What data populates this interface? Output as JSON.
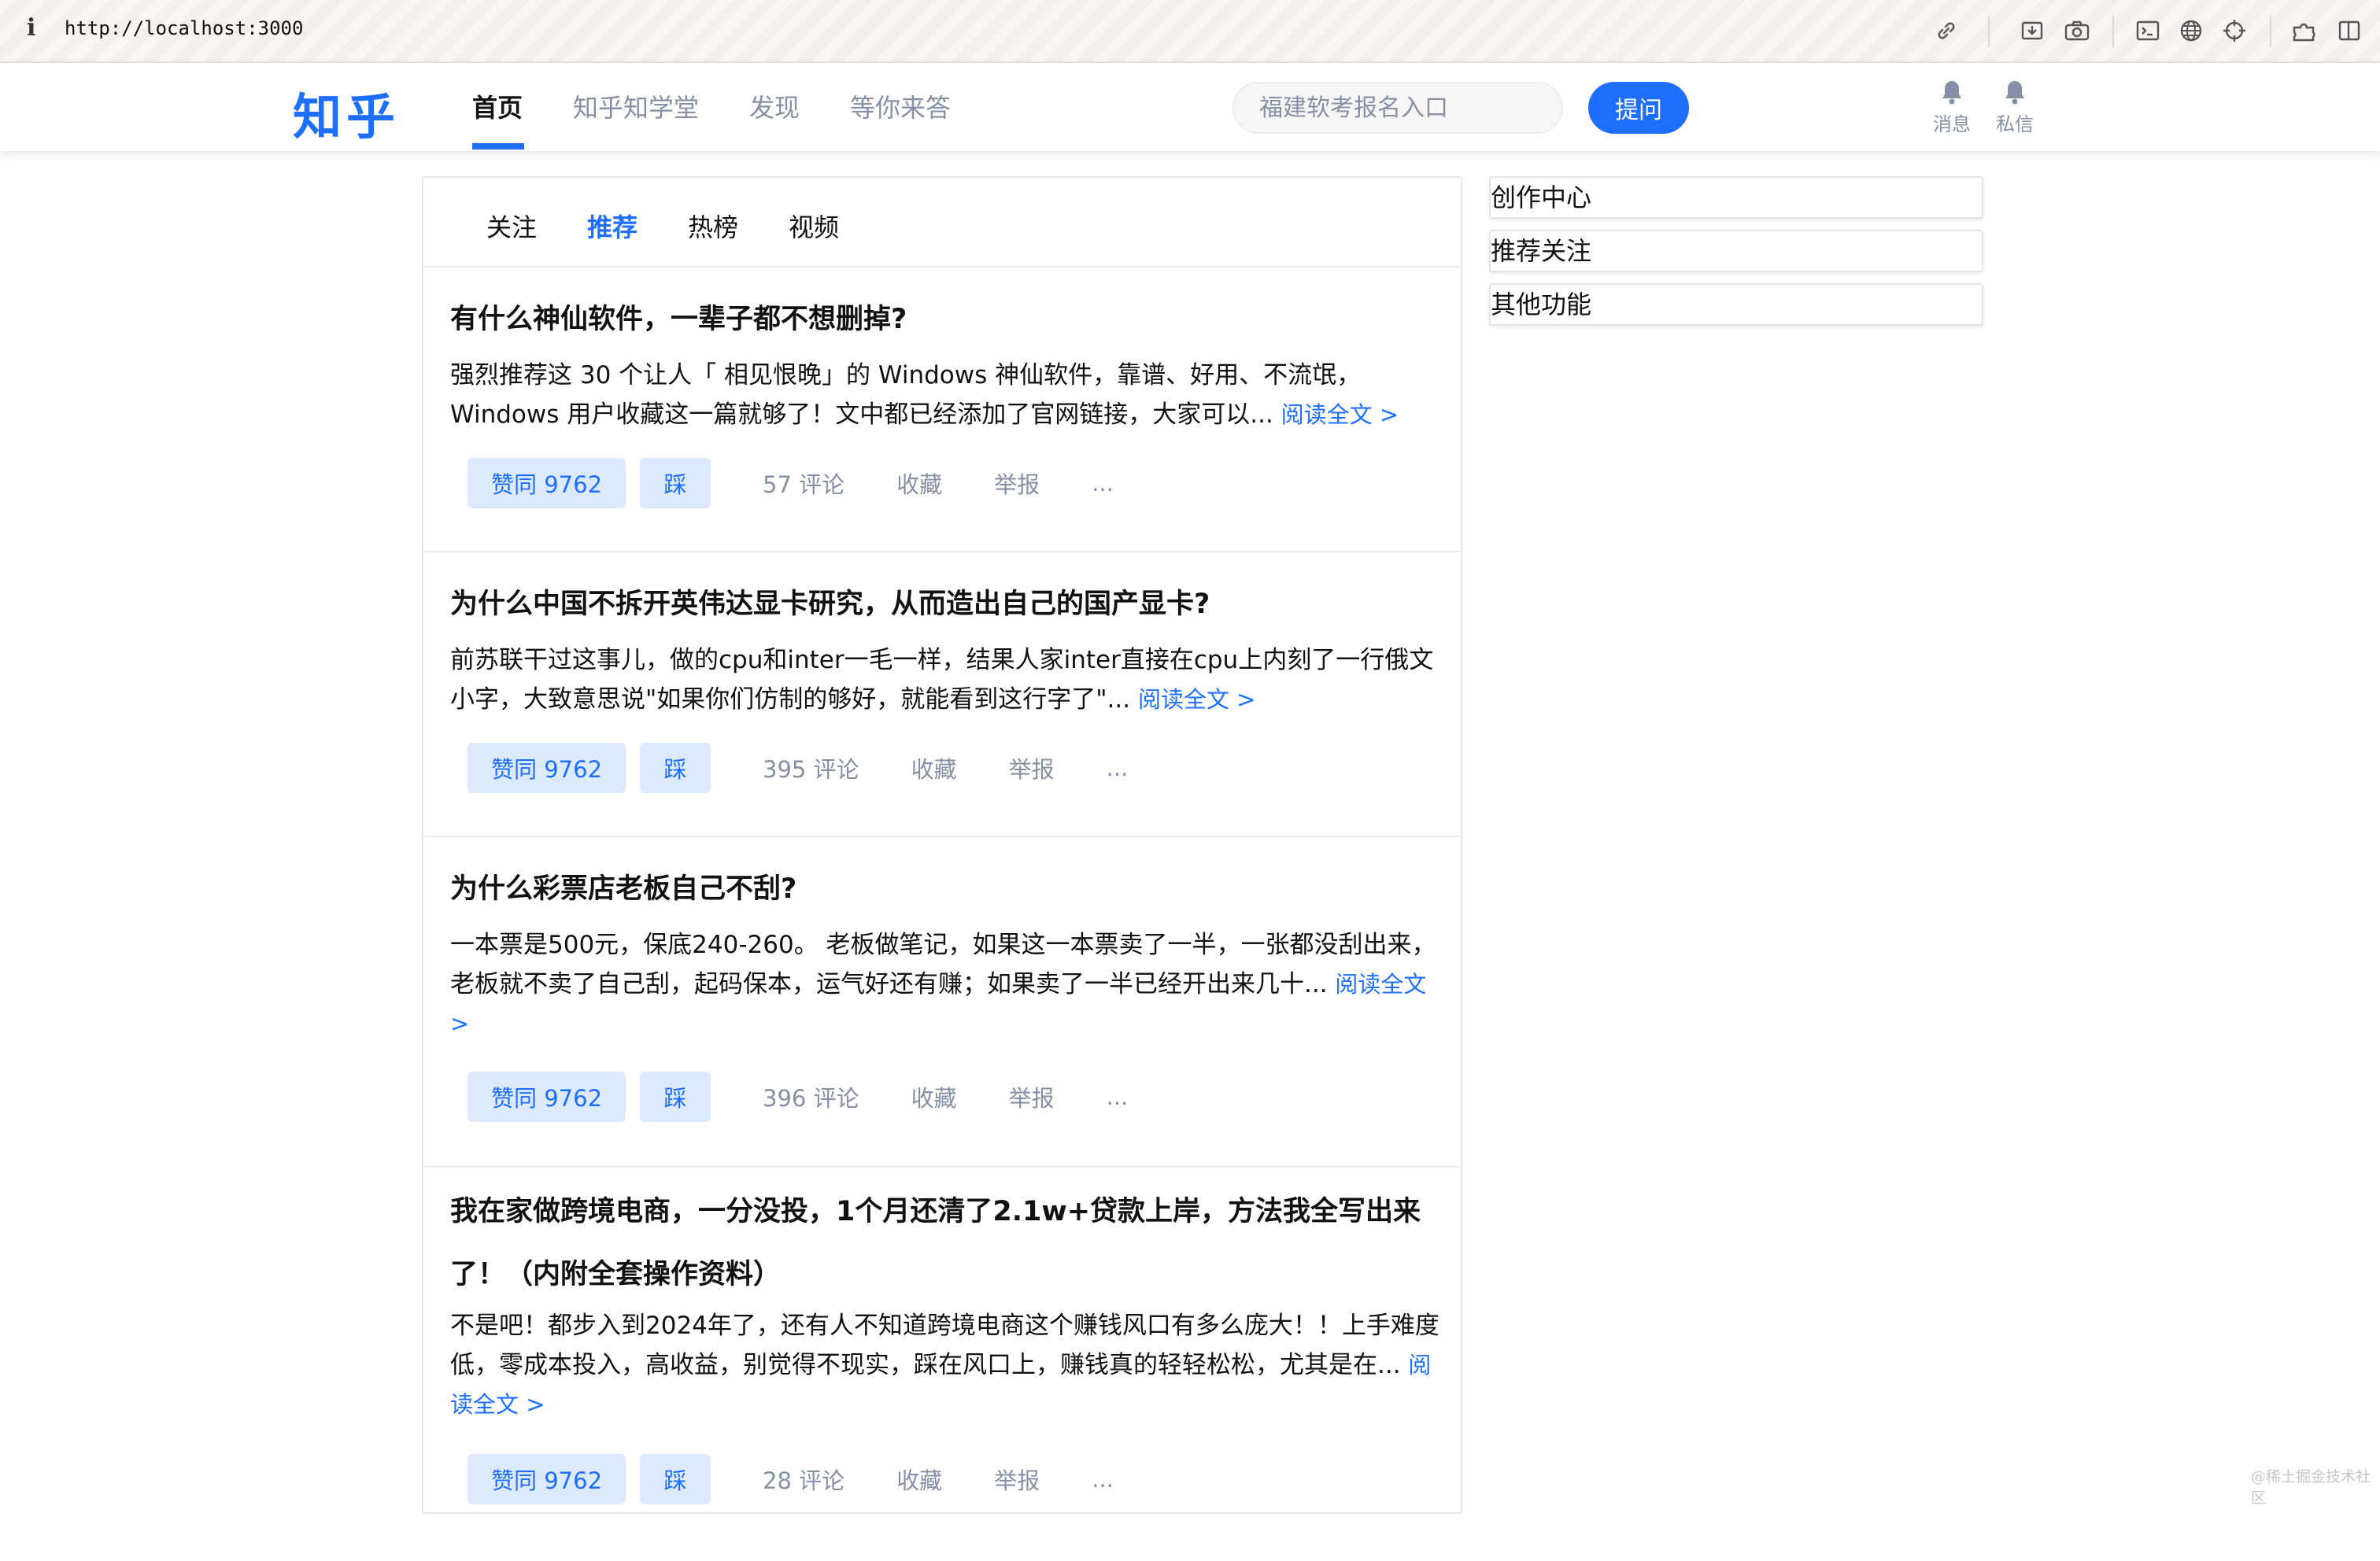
{
  "browser": {
    "info_glyph": "i",
    "url": "http://localhost:3000",
    "icons": [
      "link-icon",
      "downloads-icon",
      "camera-icon",
      "terminal-icon",
      "globe-icon",
      "crosshair-icon",
      "extensions-icon",
      "sidebar-icon"
    ]
  },
  "header": {
    "logo": "知乎",
    "nav": [
      {
        "label": "首页",
        "active": true
      },
      {
        "label": "知乎知学堂",
        "active": false
      },
      {
        "label": "发现",
        "active": false
      },
      {
        "label": "等你来答",
        "active": false
      }
    ],
    "search_placeholder": "福建软考报名入口",
    "ask_label": "提问",
    "actions": [
      {
        "label": "消息",
        "icon": "bell-icon"
      },
      {
        "label": "私信",
        "icon": "bell-icon"
      }
    ]
  },
  "feed": {
    "tabs": [
      {
        "label": "关注",
        "active": false
      },
      {
        "label": "推荐",
        "active": true
      },
      {
        "label": "热榜",
        "active": false
      },
      {
        "label": "视频",
        "active": false
      }
    ],
    "read_more": "阅读全文 >",
    "cards": [
      {
        "title": "有什么神仙软件，一辈子都不想删掉?",
        "excerpt": "强烈推荐这 30 个让人「 相见恨晚」的 Windows 神仙软件，靠谱、好用、不流氓，Windows 用户收藏这一篇就够了！文中都已经添加了官网链接，大家可以...",
        "upvote": "赞同 9762",
        "downvote": "踩",
        "comments": "57 评论",
        "collect": "收藏",
        "report": "举报",
        "more": "..."
      },
      {
        "title": "为什么中国不拆开英伟达显卡研究，从而造出自己的国产显卡?",
        "excerpt": "前苏联干过这事儿，做的cpu和inter一毛一样，结果人家inter直接在cpu上内刻了一行俄文小字，大致意思说\"如果你们仿制的够好，就能看到这行字了\"...",
        "upvote": "赞同 9762",
        "downvote": "踩",
        "comments": "395 评论",
        "collect": "收藏",
        "report": "举报",
        "more": "..."
      },
      {
        "title": "为什么彩票店老板自己不刮?",
        "excerpt": "一本票是500元，保底240-260。 老板做笔记，如果这一本票卖了一半，一张都没刮出来，老板就不卖了自己刮，起码保本，运气好还有赚；如果卖了一半已经开出来几十...",
        "upvote": "赞同 9762",
        "downvote": "踩",
        "comments": "396 评论",
        "collect": "收藏",
        "report": "举报",
        "more": "..."
      },
      {
        "title": "我在家做跨境电商，一分没投，1个月还清了2.1w+贷款上岸，方法我全写出来了！（内附全套操作资料）",
        "excerpt": "不是吧！都步入到2024年了，还有人不知道跨境电商这个赚钱风口有多么庞大！！上手难度低，零成本投入，高收益，别觉得不现实，踩在风口上，赚钱真的轻轻松松，尤其是在...",
        "upvote": "赞同 9762",
        "downvote": "踩",
        "comments": "28 评论",
        "collect": "收藏",
        "report": "举报",
        "more": "..."
      }
    ]
  },
  "sidebar": {
    "items": [
      "创作中心",
      "推荐关注",
      "其他功能"
    ]
  },
  "watermark": "@稀土掘金技术社区",
  "colors": {
    "brand": "#1e6fff",
    "muted": "#8590a6",
    "vote_bg": "#dde9fd"
  }
}
